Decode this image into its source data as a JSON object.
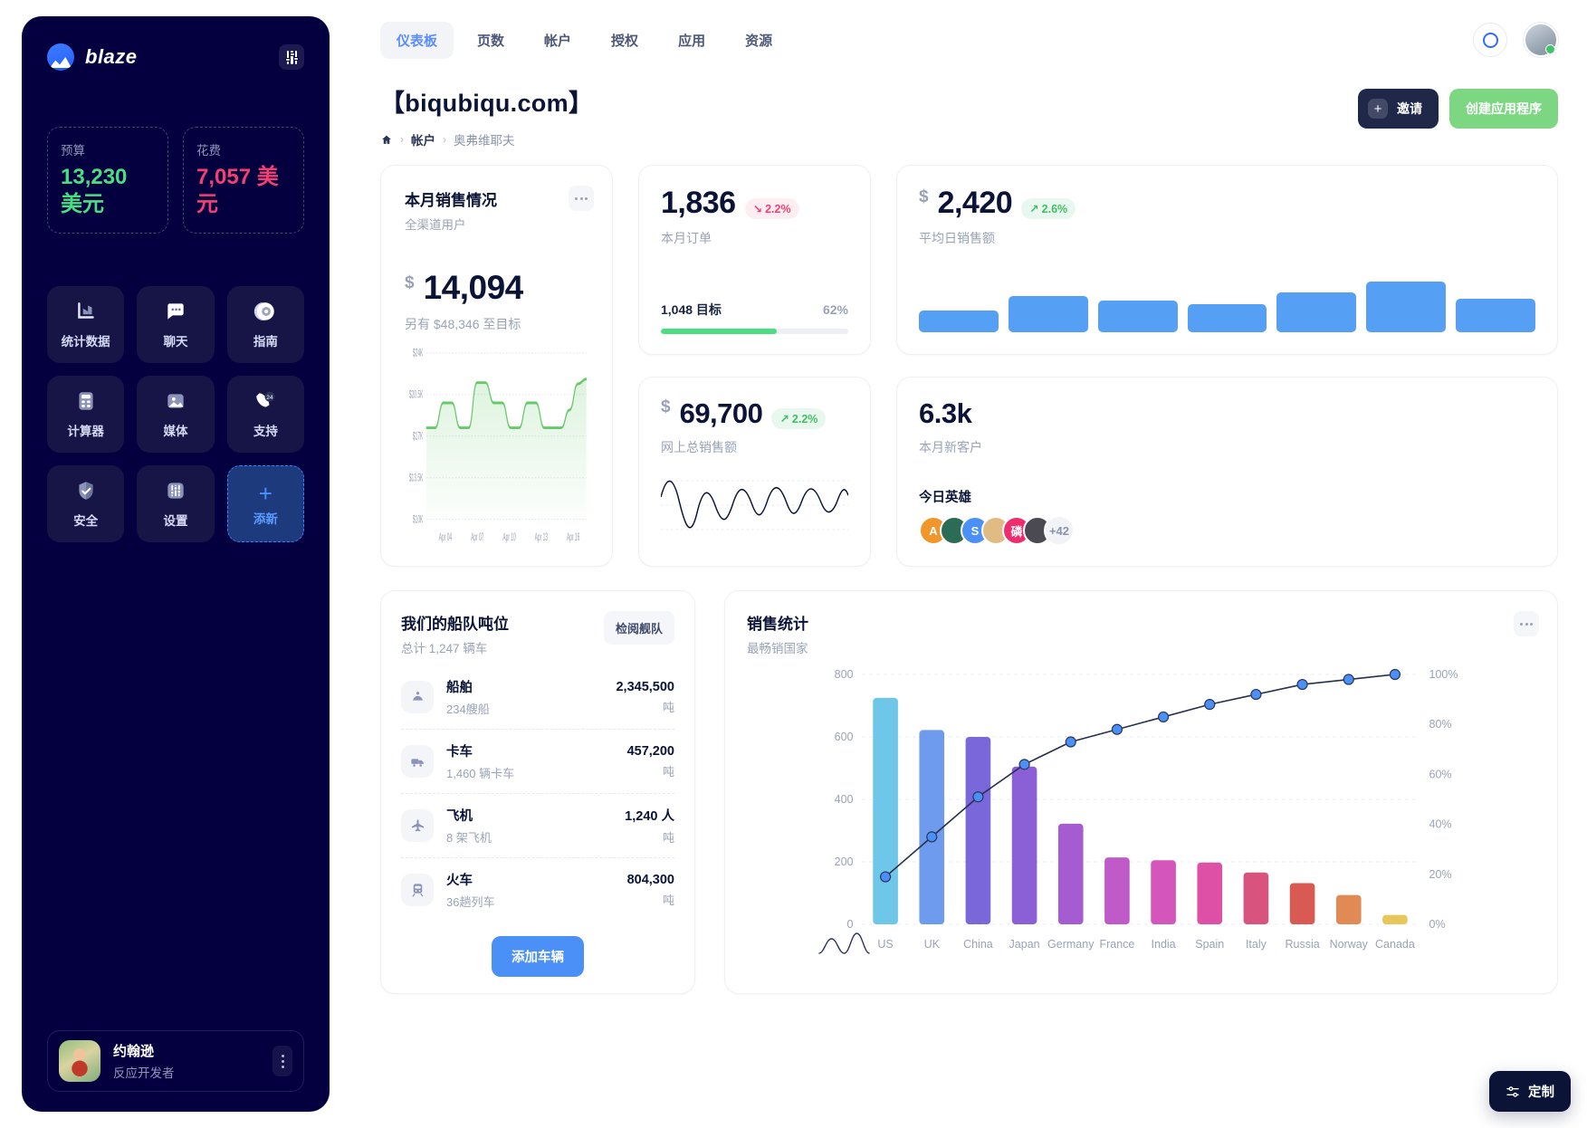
{
  "sidebar": {
    "brand": "blaze",
    "settings_icon": "sliders-icon",
    "kpis": [
      {
        "label": "预算",
        "value": "13,230 美元",
        "color": "#4ade80"
      },
      {
        "label": "花费",
        "value": "7,057 美元",
        "color": "#f43f72"
      }
    ],
    "tiles": [
      {
        "label": "统计数据",
        "icon": "bar-chart-icon"
      },
      {
        "label": "聊天",
        "icon": "chat-bubble-icon"
      },
      {
        "label": "指南",
        "icon": "compass-icon"
      },
      {
        "label": "计算器",
        "icon": "calculator-icon"
      },
      {
        "label": "媒体",
        "icon": "image-icon"
      },
      {
        "label": "支持",
        "icon": "phone-24-icon"
      },
      {
        "label": "安全",
        "icon": "shield-icon"
      },
      {
        "label": "设置",
        "icon": "sliders-icon"
      },
      {
        "label": "添新",
        "icon": "plus-icon"
      }
    ],
    "profile": {
      "name": "约翰逊",
      "role": "反应开发者",
      "menu_icon": "kebab-menu-icon"
    }
  },
  "topbar": {
    "tabs": [
      {
        "label": "仪表板",
        "active": true
      },
      {
        "label": "页数",
        "active": false
      },
      {
        "label": "帐户",
        "active": false
      },
      {
        "label": "授权",
        "active": false
      },
      {
        "label": "应用",
        "active": false
      },
      {
        "label": "资源",
        "active": false
      }
    ],
    "search_icon": "circle-icon",
    "account_avatar": "avatar"
  },
  "page": {
    "title": "【biqubiqu.com】",
    "breadcrumb": [
      {
        "label": "",
        "icon": "home-icon"
      },
      {
        "label": "帐户"
      },
      {
        "label": "奥弗维耶夫"
      }
    ],
    "invite_button": "邀请",
    "create_button": "创建应用程序"
  },
  "cards": {
    "orders": {
      "value": "1,836",
      "delta": "2.2%",
      "delta_dir": "down",
      "label": "本月订单",
      "goal_label": "1,048 目标",
      "goal_pct_text": "62%",
      "goal_pct": 62
    },
    "avg_daily": {
      "currency": "$",
      "value": "2,420",
      "delta": "2.6%",
      "delta_dir": "up",
      "label": "平均日销售额",
      "bars": [
        38,
        62,
        55,
        48,
        68,
        88,
        58
      ]
    },
    "online_total": {
      "currency": "$",
      "value": "69,700",
      "delta": "2.2%",
      "delta_dir": "up",
      "label": "网上总销售额"
    },
    "new_customers": {
      "value": "6.3k",
      "label": "本月新客户",
      "heroes_title": "今日英雄",
      "heroes": [
        {
          "initial": "A",
          "color": "#f0962b"
        },
        {
          "initial": "",
          "color": "#2c6b56"
        },
        {
          "initial": "S",
          "color": "#4a90f7"
        },
        {
          "initial": "",
          "color": "#e0bc84"
        },
        {
          "initial": "磷",
          "color": "#ef2c6e"
        },
        {
          "initial": "",
          "color": "#4b4a52"
        }
      ],
      "more_label": "+42"
    },
    "monthly_sales": {
      "title": "本月销售情况",
      "subtitle": "全渠道用户",
      "currency": "$",
      "value": "14,094",
      "note": "另有 $48,346 至目标",
      "menu_icon": "kebab-menu-icon"
    },
    "fleet": {
      "title": "我们的船队吨位",
      "subtitle": "总计 1,247 辆车",
      "action": "检阅舰队",
      "rows": [
        {
          "name": "船舶",
          "meta": "234艘船",
          "value": "2,345,500",
          "unit": "吨",
          "icon": "ship-icon"
        },
        {
          "name": "卡车",
          "meta": "1,460 辆卡车",
          "value": "457,200",
          "unit": "吨",
          "icon": "truck-icon"
        },
        {
          "name": "飞机",
          "meta": "8 架飞机",
          "value": "1,240 人",
          "unit": "吨",
          "icon": "plane-icon"
        },
        {
          "name": "火车",
          "meta": "36趟列车",
          "value": "804,300",
          "unit": "吨",
          "icon": "train-icon"
        }
      ],
      "add_button": "添加车辆"
    },
    "sales_stats": {
      "title": "销售统计",
      "subtitle": "最畅销国家",
      "menu_icon": "kebab-menu-icon",
      "brush_icon": "brush-chart-icon"
    }
  },
  "customize_button": {
    "label": "定制",
    "icon": "tune-icon"
  },
  "chart_data": [
    {
      "type": "area",
      "name": "monthly-sales-trend",
      "title": "本月销售情况",
      "subtitle": "全渠道用户",
      "xlabel": "",
      "ylabel": "",
      "ylim": [
        10000,
        24000
      ],
      "ytick_labels": [
        "$24K",
        "$20.5K",
        "$17K",
        "$13.5K",
        "$10K"
      ],
      "ytick_values": [
        24000,
        20500,
        17000,
        13500,
        10000
      ],
      "xtick_labels": [
        "Apr 04",
        "Apr 07",
        "Apr 10",
        "Apr 13",
        "Apr 16"
      ],
      "grid": true,
      "line_color": "#67c96a",
      "x": [
        1,
        2,
        3,
        4,
        5,
        6,
        7,
        8,
        9,
        10,
        11,
        12,
        13,
        14,
        15,
        16,
        17,
        18,
        19,
        20
      ],
      "values": [
        17700,
        17700,
        19800,
        19800,
        17700,
        17700,
        21500,
        21500,
        19800,
        19800,
        17700,
        17700,
        19800,
        19800,
        17700,
        17700,
        17700,
        19200,
        21400,
        21800
      ]
    },
    {
      "type": "bar",
      "name": "sales-statistics-pareto",
      "title": "销售统计",
      "subtitle": "最畅销国家",
      "categories": [
        "US",
        "UK",
        "China",
        "Japan",
        "Germany",
        "France",
        "India",
        "Spain",
        "Italy",
        "Russia",
        "Norway",
        "Canada"
      ],
      "values": [
        725,
        622,
        600,
        505,
        322,
        214,
        205,
        198,
        166,
        132,
        94,
        30
      ],
      "ylim": [
        0,
        800
      ],
      "ytick_labels": [
        "0",
        "200",
        "400",
        "600",
        "800"
      ],
      "ytick_values": [
        0,
        200,
        400,
        600,
        800
      ],
      "secondary_axis": {
        "name": "cumulative-percent",
        "type": "line",
        "ylim": [
          0,
          100
        ],
        "ytick_labels": [
          "0%",
          "20%",
          "40%",
          "60%",
          "80%",
          "100%"
        ],
        "ytick_values": [
          0,
          20,
          40,
          60,
          80,
          100
        ],
        "values": [
          19,
          35,
          51,
          64,
          73,
          78,
          83,
          88,
          92,
          96,
          98,
          100
        ],
        "marker_color": "#4a90f7",
        "line_color": "#26304f"
      },
      "bar_colors": [
        "#6ec6e8",
        "#6f9bee",
        "#7a68db",
        "#8b5fd6",
        "#a45cd0",
        "#c05ac8",
        "#d455bb",
        "#de4fa6",
        "#d9537f",
        "#d95a52",
        "#e08a55",
        "#e8c65a"
      ],
      "grid": true
    }
  ]
}
